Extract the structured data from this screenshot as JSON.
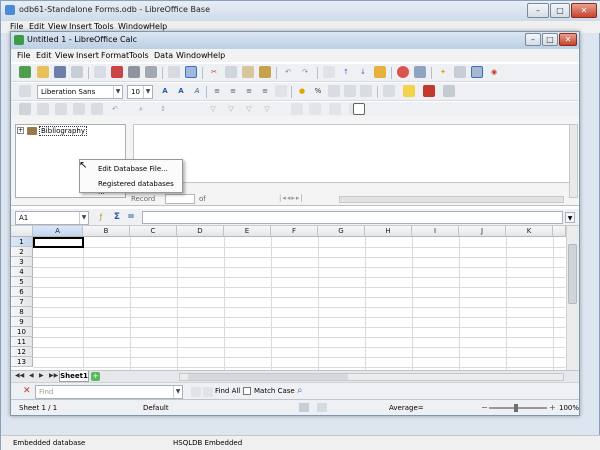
{
  "base_window": {
    "title": "odb61-Standalone Forms.odb - LibreOffice Base",
    "controls": {
      "minimize": "–",
      "maximize": "□",
      "close": "✕"
    },
    "menu": [
      "File",
      "Edit",
      "View",
      "Insert",
      "Tools",
      "Window",
      "Help"
    ],
    "status": {
      "left": "Embedded database",
      "right": "HSQLDB Embedded"
    }
  },
  "calc_window": {
    "title": "Untitled 1 - LibreOffice Calc",
    "controls": {
      "minimize": "–",
      "maximize": "□",
      "close": "✕"
    },
    "menu": [
      "File",
      "Edit",
      "View",
      "Insert",
      "Format",
      "Tools",
      "Data",
      "Window",
      "Help"
    ],
    "formatting": {
      "font_name": "Liberation Sans",
      "font_size": "10"
    },
    "data_source": {
      "tree_item": "Bibliography",
      "tree_expander": "+",
      "record_label": "Record",
      "record_of": "of",
      "context_menu": [
        "Edit Database File...",
        "Registered databases ..."
      ]
    },
    "formula_bar": {
      "name_box": "A1",
      "sum_symbol": "Σ",
      "equals_symbol": "="
    },
    "grid": {
      "columns": [
        "A",
        "B",
        "C",
        "D",
        "E",
        "F",
        "G",
        "H",
        "I",
        "J",
        "K"
      ],
      "rows": [
        "1",
        "2",
        "3",
        "4",
        "5",
        "6",
        "7",
        "8",
        "9",
        "10",
        "11",
        "12",
        "13"
      ]
    },
    "sheet_tabs": {
      "active": "Sheet1",
      "add_symbol": "+",
      "nav": [
        "◀◀",
        "◀",
        "▶",
        "▶▶"
      ]
    },
    "find_bar": {
      "placeholder": "Find",
      "find_all": "Find All",
      "match_case": "Match Case"
    },
    "status": {
      "sheet": "Sheet 1 / 1",
      "style": "Default",
      "sum": "Average=",
      "zoom": "100%"
    }
  },
  "colors": {
    "accent": "#1a6fc8",
    "title_bar": "#bccfe4",
    "close_red": "#c8422c"
  }
}
